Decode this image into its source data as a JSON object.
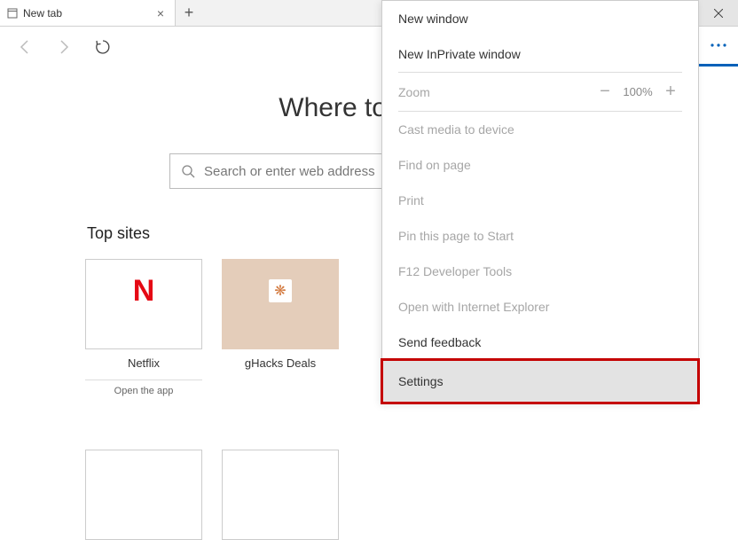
{
  "tab": {
    "title": "New tab"
  },
  "page": {
    "heading": "Where to next?",
    "search_placeholder": "Search or enter web address",
    "topsites_label": "Top sites"
  },
  "tiles": {
    "netflix": {
      "label": "Netflix",
      "sub": "Open the app"
    },
    "ghacks": {
      "label": "gHacks Deals"
    }
  },
  "menu": {
    "new_window": "New window",
    "new_inprivate": "New InPrivate window",
    "zoom_label": "Zoom",
    "zoom_value": "100%",
    "cast": "Cast media to device",
    "find": "Find on page",
    "print": "Print",
    "pin": "Pin this page to Start",
    "devtools": "F12 Developer Tools",
    "open_ie": "Open with Internet Explorer",
    "feedback": "Send feedback",
    "settings": "Settings"
  }
}
